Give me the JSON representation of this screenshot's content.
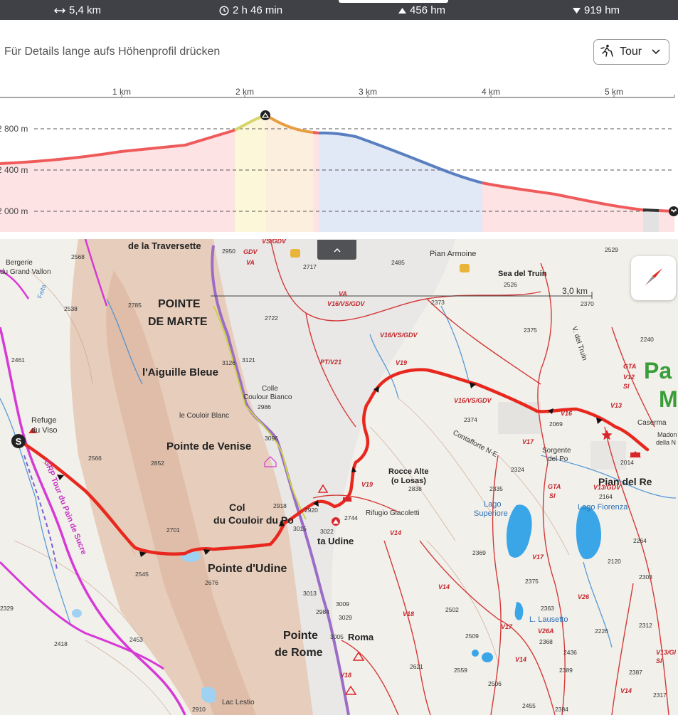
{
  "stats": {
    "distance": "5,4 km",
    "duration": "2 h 46 min",
    "ascent": "456 hm",
    "descent": "919 hm"
  },
  "profile": {
    "hint": "Für Details lange aufs Höhenprofil drücken",
    "tour_select": {
      "label": "Tour",
      "icon": "hiker-icon"
    },
    "x_ticks": [
      "1 km",
      "2 km",
      "3 km",
      "4 km",
      "5 km"
    ],
    "y_ticks": [
      "2 800 m",
      "2 400 m",
      "2 000 m"
    ],
    "colors": {
      "red": "#ef5b5b",
      "yellow": "#d6d46a",
      "orange": "#e79e43",
      "blue": "#5a7fc0",
      "black": "#333333"
    }
  },
  "map": {
    "scale_label": "3,0 km",
    "start_marker": "S",
    "labels": {
      "traversette": "de la Traversette",
      "pointe_marte_1": "POINTE",
      "pointe_marte_2": "DE MARTE",
      "aiguille": "l'Aiguille Bleue",
      "couloir_blanc": "le Couloir Blanc",
      "colle_1": "Colle",
      "colle_2": "Coulour Bianco",
      "pointe_venise": "Pointe de Venise",
      "col_1": "Col",
      "col_2": "du Couloir du Po",
      "pointe_udine": "Pointe d'Udine",
      "udine": "ta Udine",
      "pointe_rome_1": "Pointe",
      "pointe_rome_2": "de Rome",
      "roma": "Roma",
      "refuge_1": "Refuge",
      "refuge_2": "du Viso",
      "bergerie_1": "Bergerie",
      "bergerie_2": "du Grand Vallon",
      "rocce_1": "Rocce Alte",
      "rocce_2": "(o Losas)",
      "rifugio": "Rifugio Giacoletti",
      "pian_armoine": "Pian Armoine",
      "sea_truin": "Sea del Truin",
      "contafforte": "Contafforte N-E",
      "sorgente_1": "Sorgente",
      "sorgente_2": "del Po",
      "pian_re": "Pian del Re",
      "lago_sup_1": "Lago",
      "lago_sup_2": "Superiore",
      "lago_fiorenza": "Lago Fiorenza",
      "lago_lausetto": "L. Lausetto",
      "caserma": "Caserma",
      "madonna_1": "Madon",
      "madonna_2": "della N",
      "v_truin": "V. del Truin",
      "lac_lestio": "Lac Lestio",
      "pian_po_1": "Pa",
      "pian_po_2": "M",
      "tour_viso": "GRP Tour du Pain de Sucre",
      "faita": "Faita"
    },
    "trail_labels": [
      "VS/GDV",
      "GDV",
      "VA",
      "V16/VS/GDV",
      "VA",
      "V16/VS/GDV",
      "PT/V21",
      "V19",
      "V16/VS/GDV",
      "V16",
      "V13",
      "GTA",
      "V12",
      "SI",
      "V17",
      "GTA",
      "SI",
      "V13/GDV",
      "V19",
      "V14",
      "V17",
      "V14",
      "V18",
      "V17",
      "V26A",
      "V26",
      "V14",
      "V14",
      "V13/GI",
      "SI",
      "V18"
    ],
    "elevations": [
      "2950",
      "2717",
      "2485",
      "2529",
      "2526",
      "2373",
      "2370",
      "2722",
      "2375",
      "2240",
      "2568",
      "2785",
      "2538",
      "3121",
      "2461",
      "2986",
      "3126",
      "2374",
      "2069",
      "2566",
      "2852",
      "3096",
      "2324",
      "2014",
      "2838",
      "2335",
      "2164",
      "2918",
      "2920",
      "2744",
      "2701",
      "3015",
      "3022",
      "2545",
      "2369",
      "2120",
      "2264",
      "2676",
      "2375",
      "2303",
      "3013",
      "3009",
      "2984",
      "3029",
      "2363",
      "2329",
      "2502",
      "2312",
      "3005",
      "2418",
      "2453",
      "2509",
      "2226",
      "2368",
      "2436",
      "2621",
      "2559",
      "2389",
      "2387",
      "2506",
      "2317",
      "2910",
      "2455",
      "2384"
    ]
  }
}
